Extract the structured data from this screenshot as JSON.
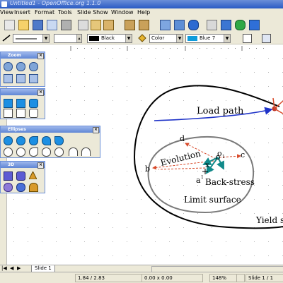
{
  "window": {
    "title": "Untitled1 - OpenOffice.org 1.1.0"
  },
  "menu": [
    "View",
    "Insert",
    "Format",
    "Tools",
    "Slide Show",
    "Window",
    "Help"
  ],
  "toolbar2": {
    "line_style": "",
    "line_color": "Black",
    "area_style": "Color",
    "area_color": "Blue 7",
    "line_color_hex": "#000000",
    "area_color_hex": "#0f9cdb"
  },
  "palettes": [
    {
      "title": "Zoom"
    },
    {
      "title": ""
    },
    {
      "title": "Ellipses"
    },
    {
      "title": "3D"
    }
  ],
  "diagram": {
    "load_path": "Load path",
    "evolution": "Evolution",
    "back_stress": "Back-stress",
    "limit_surface": "Limit surface",
    "yield_surface": "Yield s",
    "point_d": "d",
    "point_c": "c",
    "point_b": "b",
    "point_a": "a",
    "point_o": "o",
    "sub_o": "1",
    "point_x": "x",
    "point_a_prime": "a",
    "sup_prime": "1"
  },
  "tabs": {
    "active": "Slide 1"
  },
  "status": {
    "position": "1.84 / 2.83",
    "size": "0.00 x 0.00",
    "zoom": "148%",
    "page": "Slide 1 / 1"
  },
  "colors": {
    "accent": "#2a5bc4",
    "load_path": "#1f33c8",
    "arrow_red": "#d84a2a",
    "teal": "#118a8a"
  }
}
